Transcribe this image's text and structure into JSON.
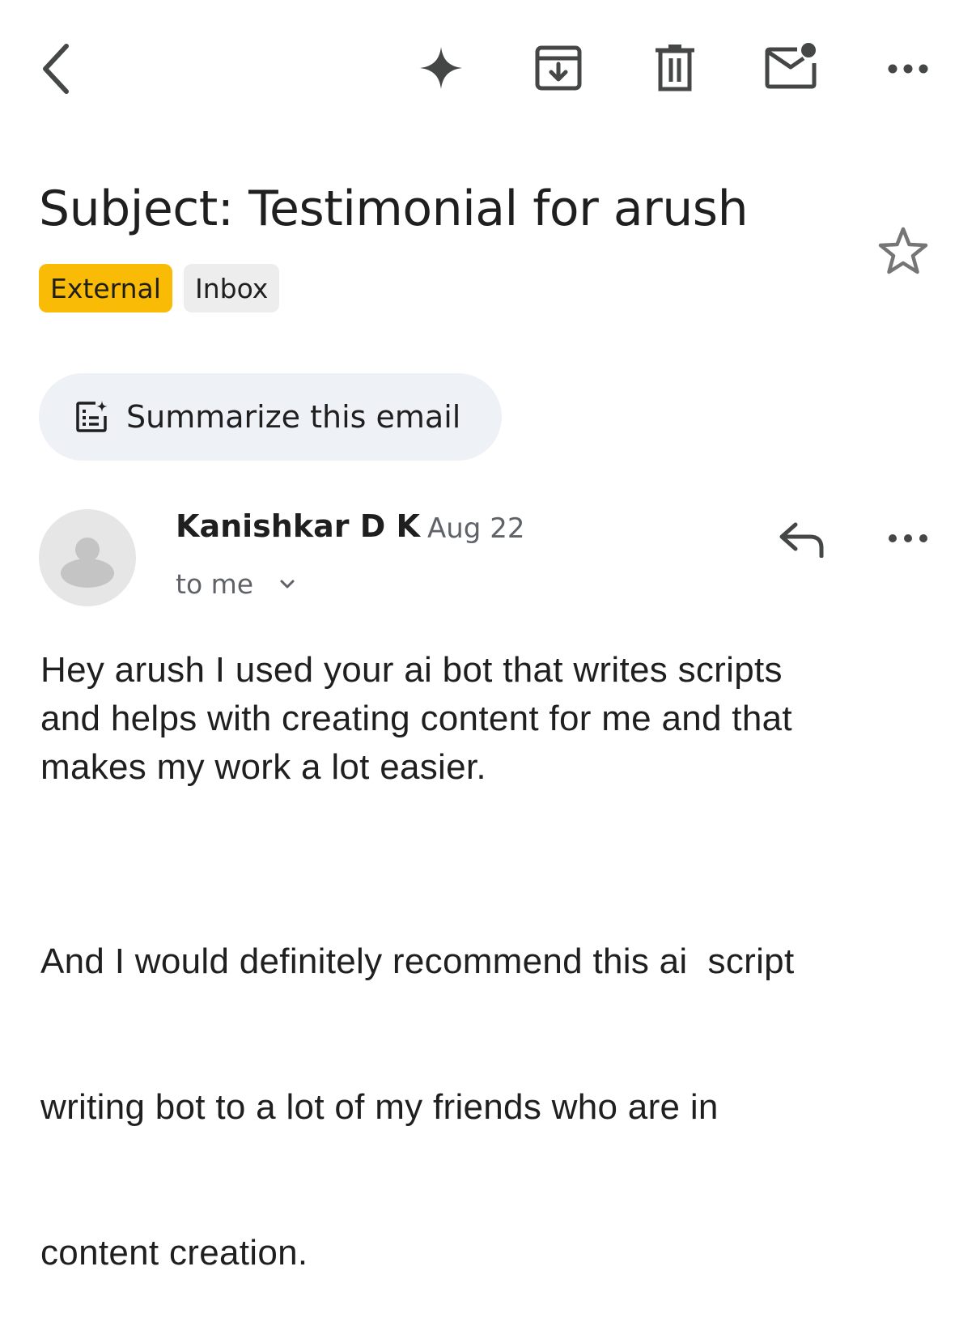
{
  "toolbar": {
    "icons": [
      "back-icon",
      "gemini-icon",
      "archive-icon",
      "delete-icon",
      "mark-unread-icon",
      "more-icon"
    ]
  },
  "email": {
    "subject": "Subject: Testimonial for arush",
    "labels": [
      "External",
      "Inbox"
    ],
    "label_colors": {
      "External": "#f9bb06",
      "Inbox": "#ededed"
    },
    "starred": false
  },
  "summarize": {
    "label": "Summarize this email"
  },
  "message": {
    "sender": "Kanishkar D K",
    "date": "Aug 22",
    "recipient": "to me",
    "body": [
      "Hey arush I used your ai bot that writes scripts",
      "and helps with creating content for me and that",
      "makes my work a lot easier.",
      "And I would definitely recommend this ai  script",
      "writing bot to a lot of my friends who are in",
      "content creation."
    ]
  }
}
